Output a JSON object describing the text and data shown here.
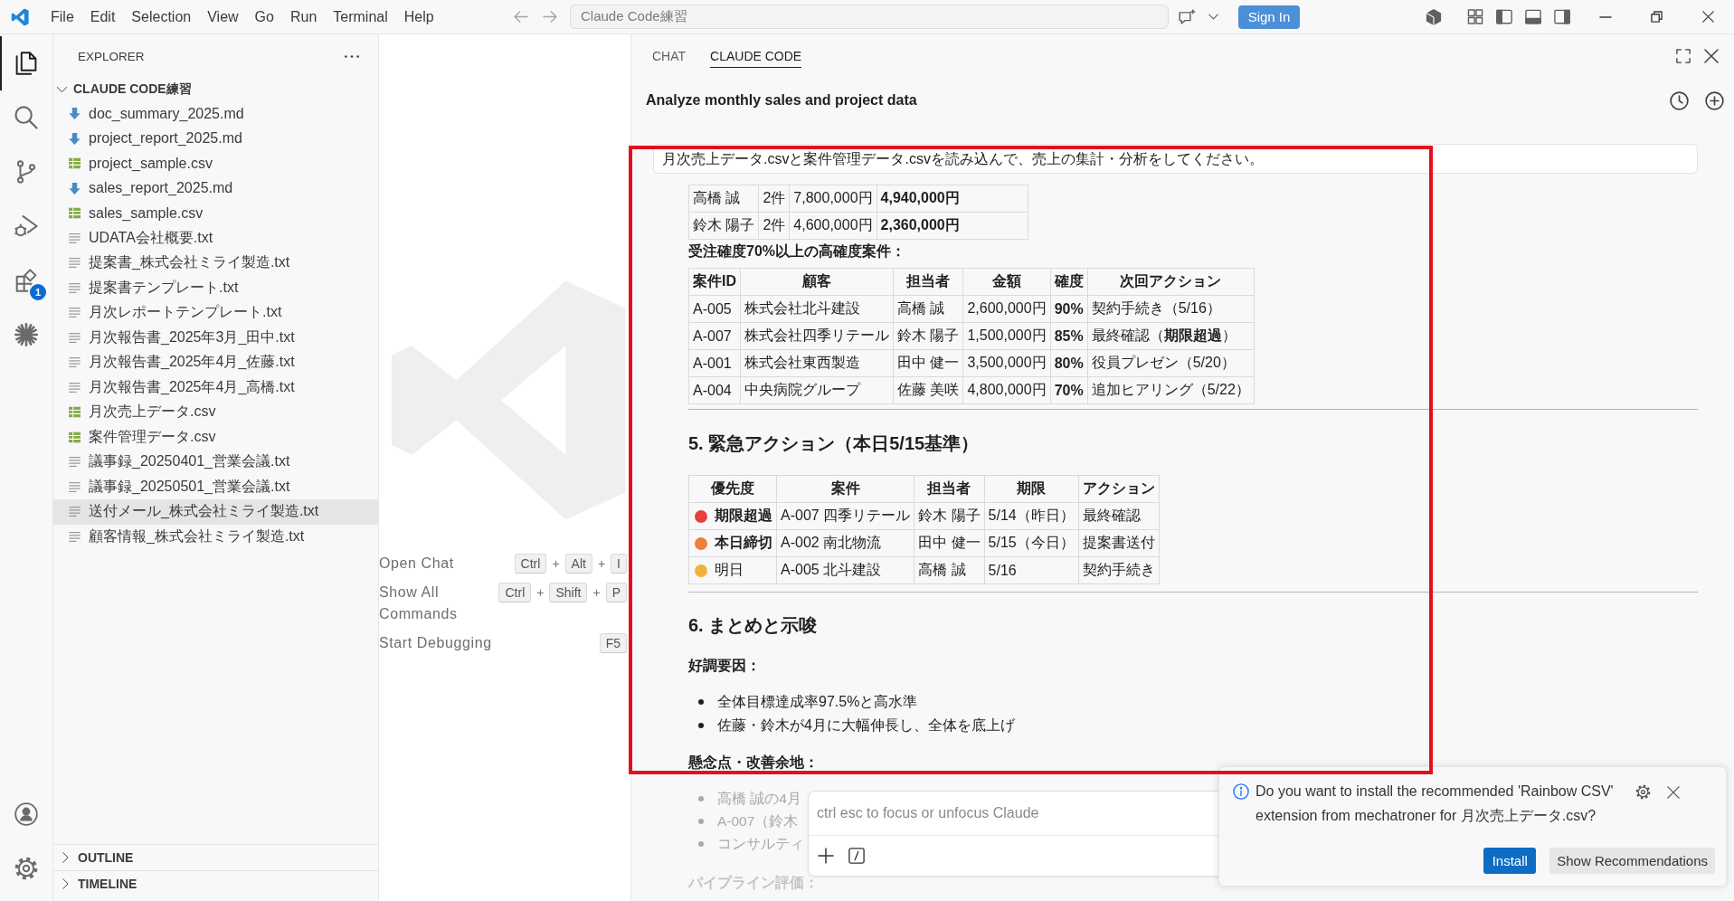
{
  "title_bar": {
    "menus": [
      "File",
      "Edit",
      "Selection",
      "View",
      "Go",
      "Run",
      "Terminal",
      "Help"
    ],
    "search": {
      "value": "Claude Code練習"
    },
    "sign_in": "Sign In"
  },
  "activity_bar": {
    "items": [
      {
        "kind": "explorer",
        "selected": true
      },
      {
        "kind": "search",
        "selected": false
      },
      {
        "kind": "source_control",
        "selected": false
      },
      {
        "kind": "run_debug",
        "selected": false
      },
      {
        "kind": "extensions",
        "selected": false,
        "badge": "1"
      },
      {
        "kind": "claude",
        "selected": false
      }
    ],
    "bottom": [
      {
        "kind": "account"
      },
      {
        "kind": "settings"
      }
    ]
  },
  "explorer": {
    "title": "EXPLORER",
    "folder": {
      "name": "CLAUDE CODE練習",
      "expanded": true,
      "files": [
        {
          "name": "doc_summary_2025.md",
          "kind": "md",
          "selected": false
        },
        {
          "name": "project_report_2025.md",
          "kind": "md",
          "selected": false
        },
        {
          "name": "project_sample.csv",
          "kind": "csv",
          "selected": false
        },
        {
          "name": "sales_report_2025.md",
          "kind": "md",
          "selected": false
        },
        {
          "name": "sales_sample.csv",
          "kind": "csv",
          "selected": false
        },
        {
          "name": "UDATA会社概要.txt",
          "kind": "txt",
          "selected": false
        },
        {
          "name": "提案書_株式会社ミライ製造.txt",
          "kind": "txt",
          "selected": false
        },
        {
          "name": "提案書テンプレート.txt",
          "kind": "txt",
          "selected": false
        },
        {
          "name": "月次レポートテンプレート.txt",
          "kind": "txt",
          "selected": false
        },
        {
          "name": "月次報告書_2025年3月_田中.txt",
          "kind": "txt",
          "selected": false
        },
        {
          "name": "月次報告書_2025年4月_佐藤.txt",
          "kind": "txt",
          "selected": false
        },
        {
          "name": "月次報告書_2025年4月_高橋.txt",
          "kind": "txt",
          "selected": false
        },
        {
          "name": "月次売上データ.csv",
          "kind": "csv",
          "selected": false
        },
        {
          "name": "案件管理データ.csv",
          "kind": "csv",
          "selected": false
        },
        {
          "name": "議事録_20250401_営業会議.txt",
          "kind": "txt",
          "selected": false
        },
        {
          "name": "議事録_20250501_営業会議.txt",
          "kind": "txt",
          "selected": false
        },
        {
          "name": "送付メール_株式会社ミライ製造.txt",
          "kind": "txt",
          "selected": true
        },
        {
          "name": "顧客情報_株式会社ミライ製造.txt",
          "kind": "txt",
          "selected": false
        }
      ]
    },
    "sections": [
      {
        "label": "OUTLINE",
        "expanded": false
      },
      {
        "label": "TIMELINE",
        "expanded": false
      }
    ]
  },
  "editor": {
    "shortcuts": [
      {
        "label": "Open Chat",
        "keys": [
          "Ctrl",
          "Alt",
          "I"
        ],
        "separators": [
          "+",
          "+"
        ]
      },
      {
        "label": "Show All Commands",
        "keys": [
          "Ctrl",
          "Shift",
          "P"
        ],
        "separators": [
          "+",
          "+"
        ]
      },
      {
        "label": "Start Debugging",
        "keys": [
          "F5"
        ]
      }
    ]
  },
  "chat": {
    "tabs": [
      {
        "label": "CHAT",
        "selected": false
      },
      {
        "label": "CLAUDE CODE",
        "selected": true
      }
    ],
    "title": "Analyze monthly sales and project data",
    "user_message": "月次売上データ.csvと案件管理データ.csvを読み込んで、売上の集計・分析をしてください。",
    "summary_table": {
      "rows": [
        [
          "高橋 誠",
          "2件",
          "7,800,000円",
          "4,940,000円"
        ],
        [
          "鈴木 陽子",
          "2件",
          "4,600,000円",
          "2,360,000円"
        ]
      ]
    },
    "high_probability": {
      "heading": "受注確度70%以上の高確度案件：",
      "columns": [
        "案件ID",
        "顧客",
        "担当者",
        "金額",
        "確度",
        "次回アクション"
      ],
      "rows": [
        [
          "A-005",
          "株式会社北斗建設",
          "高橋 誠",
          "2,600,000円",
          "90%",
          "契約手続き（5/16）"
        ],
        [
          "A-007",
          "株式会社四季リテール",
          "鈴木 陽子",
          "1,500,000円",
          "85%",
          "最終確認（**期限超過**）"
        ],
        [
          "A-001",
          "株式会社東西製造",
          "田中 健一",
          "3,500,000円",
          "80%",
          "役員プレゼン（5/20）"
        ],
        [
          "A-004",
          "中央病院グループ",
          "佐藤 美咲",
          "4,800,000円",
          "70%",
          "追加ヒアリング（5/22）"
        ]
      ]
    },
    "urgent_actions": {
      "heading": "5. 緊急アクション（本日5/15基準）",
      "columns": [
        "優先度",
        "案件",
        "担当者",
        "期限",
        "アクション"
      ],
      "rows": [
        {
          "color": "#e8403a",
          "bold": true,
          "cells": [
            "期限超過",
            "A-007 四季リテール",
            "鈴木 陽子",
            "5/14（昨日）",
            "最終確認"
          ]
        },
        {
          "color": "#ef7d3c",
          "bold": true,
          "cells": [
            "本日締切",
            "A-002 南北物流",
            "田中 健一",
            "5/15（今日）",
            "提案書送付"
          ]
        },
        {
          "color": "#f0b43c",
          "bold": false,
          "cells": [
            "明日",
            "A-005 北斗建設",
            "高橋 誠",
            "5/16",
            "契約手続き"
          ]
        }
      ]
    },
    "summary": {
      "heading": "6. まとめと示唆",
      "strengths": {
        "heading": "好調要因：",
        "items": [
          "全体目標達成率97.5%と高水準",
          "佐藤・鈴木が4月に大幅伸長し、全体を底上げ"
        ]
      },
      "concerns": {
        "heading": "懸念点・改善余地：",
        "items": [
          "高橋 誠の4月",
          "A-007（鈴木",
          "コンサルティ"
        ]
      },
      "pipeline_heading": "パイプライン評価："
    },
    "input": {
      "placeholder": "ctrl esc to focus or unfocus Claude"
    }
  },
  "notification": {
    "message": "Do you want to install the recommended 'Rainbow CSV' extension from mechatroner for 月次売上データ.csv?",
    "buttons": [
      {
        "label": "Install",
        "kind": "primary"
      },
      {
        "label": "Show Recommendations",
        "kind": "secondary"
      }
    ]
  }
}
